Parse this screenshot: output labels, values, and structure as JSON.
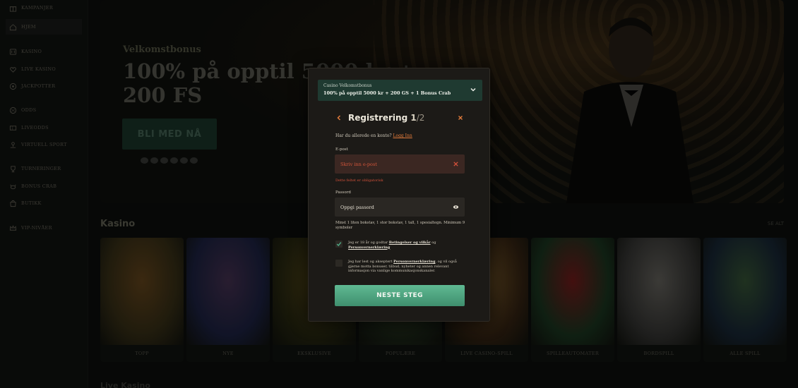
{
  "sidebar": {
    "items": [
      {
        "label": "KAMPANJER",
        "icon": "gift-icon"
      },
      {
        "label": "HJEM",
        "icon": "home-icon"
      },
      {
        "label": "KASINO",
        "icon": "slot-icon"
      },
      {
        "label": "LIVE KASINO",
        "icon": "heart-icon"
      },
      {
        "label": "JACKPOTTER",
        "icon": "target-icon"
      },
      {
        "label": "ODDS",
        "icon": "ball-icon"
      },
      {
        "label": "LIVEODDS",
        "icon": "ticket-icon"
      },
      {
        "label": "VIRTUELL SPORT",
        "icon": "joystick-icon"
      },
      {
        "label": "TURNERINGER",
        "icon": "trophy-icon"
      },
      {
        "label": "BONUS CRAB",
        "icon": "crab-icon"
      },
      {
        "label": "BUTIKK",
        "icon": "shop-icon"
      },
      {
        "label": "VIP-NIVÅER",
        "icon": "crown-icon"
      }
    ]
  },
  "hero": {
    "subtitle": "Velkomstbonus",
    "title": "100% på opptil 5000 kr + 200 FS",
    "cta": "BLI MED NÅ"
  },
  "casino": {
    "title": "Kasino",
    "see_all": "SE ALT",
    "tiles": [
      {
        "label": "TOPP",
        "colors": [
          "#3a3218",
          "#6b4a1f"
        ]
      },
      {
        "label": "NYE",
        "colors": [
          "#1f2547",
          "#4a3557"
        ]
      },
      {
        "label": "EKSKLUSIVE",
        "colors": [
          "#2a2a12",
          "#5a4d19"
        ]
      },
      {
        "label": "POPULÆRE",
        "colors": [
          "#1f2a1a",
          "#3a4a2a"
        ]
      },
      {
        "label": "LIVE CASINO-SPILL",
        "colors": [
          "#3a2714",
          "#7a5a2a"
        ]
      },
      {
        "label": "SPILLEAUTOMATER",
        "colors": [
          "#1d3a22",
          "#7a1d1d"
        ]
      },
      {
        "label": "BORDSPILL",
        "colors": [
          "#3a3a38",
          "#6c6a64"
        ]
      },
      {
        "label": "ALLE SPILL",
        "colors": [
          "#1a2a3a",
          "#3a5a3a"
        ]
      }
    ],
    "next_title": "Live Kasino"
  },
  "modal": {
    "bonus_label": "Casino Velkomstbonus",
    "bonus_value": "100% på opptil 5000 kr + 200 GS + 1 Bonus Crab",
    "title": "Registrering",
    "step": "1",
    "total": "/2",
    "have_account": "Har du allerede en konto?",
    "login_link": "Logg Inn",
    "email_label": "E-post",
    "email_placeholder": "Skriv inn e-post",
    "email_error": "Dette feltet er obligatorisk",
    "password_label": "Passord",
    "password_placeholder": "Oppgi passord",
    "password_hint": "Minst 1 liten bokstav, 1 stor bokstav, 1 tall, 1 spesialtegn. Minimum 9 symboler",
    "terms_text_1": "Jeg er 18 år og godtar",
    "terms_link": "Betingelser og vilkår",
    "terms_text_2": "og",
    "privacy_link": "Personvernerklæring",
    "marketing_text_1": "Jeg har lest og akseptert",
    "marketing_link": "Personvernerklæring",
    "marketing_text_2": ", og vil også gjerne motta bonuser, tilbud, nyheter og annen relevant informasjon via vanlige kommunikasjonskanaler.",
    "cta": "NESTE STEG",
    "colors": {
      "accent": "#4fa884",
      "error": "#d4513a",
      "link": "#e07a3b"
    }
  }
}
